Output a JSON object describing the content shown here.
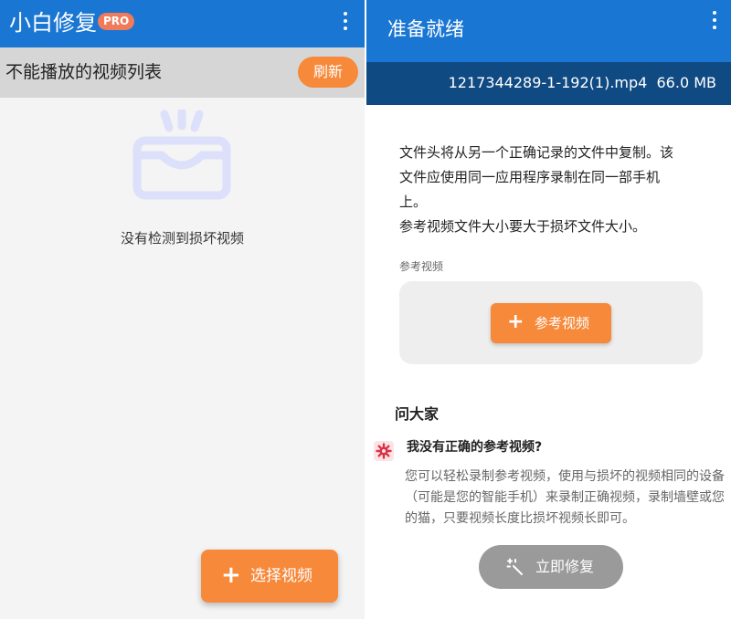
{
  "left": {
    "app_title": "小白修复",
    "pro_badge": "PRO",
    "list_title": "不能播放的视频列表",
    "refresh_label": "刷新",
    "empty_text": "没有检测到损坏视频",
    "select_video_label": "选择视频",
    "icons": {
      "overflow": "more-vertical-icon",
      "empty_state": "inbox-icon",
      "add": "plus-icon"
    }
  },
  "right": {
    "app_title": "准备就绪",
    "file_name": "1217344289-1-192(1).mp4",
    "file_size": "66.0 MB",
    "description": [
      "文件头将从另一个正确记录的文件中复制。该",
      "文件应使用同一应用程序录制在同一部手机",
      "上。",
      "参考视频文件大小要大于损坏文件大小。"
    ],
    "ref_section_label": "参考视频",
    "ref_button_label": "参考视频",
    "faq_heading": "问大家",
    "faq_question": "我没有正确的参考视频?",
    "faq_answer": "您可以轻松录制参考视频，使用与损坏的视频相同的设备（可能是您的智能手机）来录制正确视频，录制墙壁或您的猫，只要视频长度比损坏视频长即可。",
    "repair_button_label": "立即修复",
    "icons": {
      "overflow": "more-vertical-icon",
      "faq": "gear-icon",
      "repair": "magic-wand-icon"
    }
  },
  "colors": {
    "app_bar": "#1976d2",
    "file_bar": "#104a83",
    "accent": "#f7893b",
    "pro_badge": "#f07a5a",
    "disabled_button": "#9a9a9a",
    "list_header": "#d6d6d6",
    "empty_icon": "#dde0fa"
  }
}
